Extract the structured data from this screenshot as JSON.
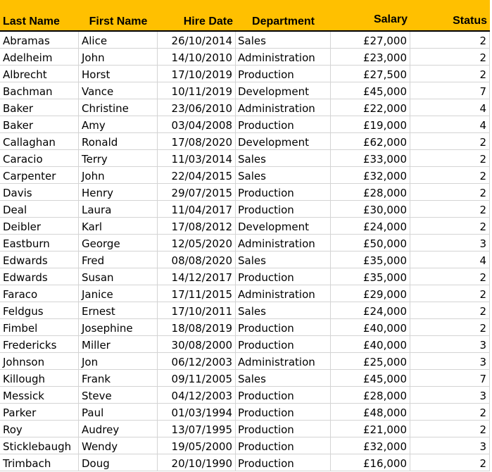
{
  "headers": {
    "last_name": "Last Name",
    "first_name": "First Name",
    "hire_date": "Hire Date",
    "department": "Department",
    "salary": "Salary",
    "status": "Status"
  },
  "rows": [
    {
      "last": "Abramas",
      "first": "Alice",
      "hire": "26/10/2014",
      "dept": "Sales",
      "salary": "£27,000",
      "status": "2"
    },
    {
      "last": "Adelheim",
      "first": "John",
      "hire": "14/10/2010",
      "dept": "Administration",
      "salary": "£23,000",
      "status": "2"
    },
    {
      "last": "Albrecht",
      "first": "Horst",
      "hire": "17/10/2019",
      "dept": "Production",
      "salary": "£27,500",
      "status": "2"
    },
    {
      "last": "Bachman",
      "first": "Vance",
      "hire": "10/11/2019",
      "dept": "Development",
      "salary": "£45,000",
      "status": "7"
    },
    {
      "last": "Baker",
      "first": "Christine",
      "hire": "23/06/2010",
      "dept": "Administration",
      "salary": "£22,000",
      "status": "4"
    },
    {
      "last": "Baker",
      "first": "Amy",
      "hire": "03/04/2008",
      "dept": "Production",
      "salary": "£19,000",
      "status": "4"
    },
    {
      "last": "Callaghan",
      "first": "Ronald",
      "hire": "17/08/2020",
      "dept": "Development",
      "salary": "£62,000",
      "status": "2"
    },
    {
      "last": "Caracio",
      "first": "Terry",
      "hire": "11/03/2014",
      "dept": "Sales",
      "salary": "£33,000",
      "status": "2"
    },
    {
      "last": "Carpenter",
      "first": "John",
      "hire": "22/04/2015",
      "dept": "Sales",
      "salary": "£32,000",
      "status": "2"
    },
    {
      "last": "Davis",
      "first": "Henry",
      "hire": "29/07/2015",
      "dept": "Production",
      "salary": "£28,000",
      "status": "2"
    },
    {
      "last": "Deal",
      "first": "Laura",
      "hire": "11/04/2017",
      "dept": "Production",
      "salary": "£30,000",
      "status": "2"
    },
    {
      "last": "Deibler",
      "first": "Karl",
      "hire": "17/08/2012",
      "dept": "Development",
      "salary": "£24,000",
      "status": "2"
    },
    {
      "last": "Eastburn",
      "first": "George",
      "hire": "12/05/2020",
      "dept": "Administration",
      "salary": "£50,000",
      "status": "3"
    },
    {
      "last": "Edwards",
      "first": "Fred",
      "hire": "08/08/2020",
      "dept": "Sales",
      "salary": "£35,000",
      "status": "4"
    },
    {
      "last": "Edwards",
      "first": "Susan",
      "hire": "14/12/2017",
      "dept": "Production",
      "salary": "£35,000",
      "status": "2"
    },
    {
      "last": "Faraco",
      "first": "Janice",
      "hire": "17/11/2015",
      "dept": "Administration",
      "salary": "£29,000",
      "status": "2"
    },
    {
      "last": "Feldgus",
      "first": "Ernest",
      "hire": "17/10/2011",
      "dept": "Sales",
      "salary": "£24,000",
      "status": "2"
    },
    {
      "last": "Fimbel",
      "first": "Josephine",
      "hire": "18/08/2019",
      "dept": "Production",
      "salary": "£40,000",
      "status": "2"
    },
    {
      "last": "Fredericks",
      "first": "Miller",
      "hire": "30/08/2000",
      "dept": "Production",
      "salary": "£40,000",
      "status": "3"
    },
    {
      "last": "Johnson",
      "first": "Jon",
      "hire": "06/12/2003",
      "dept": "Administration",
      "salary": "£25,000",
      "status": "3"
    },
    {
      "last": "Killough",
      "first": "Frank",
      "hire": "09/11/2005",
      "dept": "Sales",
      "salary": "£45,000",
      "status": "7"
    },
    {
      "last": "Messick",
      "first": "Steve",
      "hire": "04/12/2003",
      "dept": "Production",
      "salary": "£28,000",
      "status": "3"
    },
    {
      "last": "Parker",
      "first": "Paul",
      "hire": "01/03/1994",
      "dept": "Production",
      "salary": "£48,000",
      "status": "2"
    },
    {
      "last": "Roy",
      "first": "Audrey",
      "hire": "13/07/1995",
      "dept": "Production",
      "salary": "£21,000",
      "status": "2"
    },
    {
      "last": "Sticklebaugh",
      "first": "Wendy",
      "hire": "19/05/2000",
      "dept": "Production",
      "salary": "£32,000",
      "status": "3"
    },
    {
      "last": "Trimbach",
      "first": "Doug",
      "hire": "20/10/1990",
      "dept": "Production",
      "salary": "£16,000",
      "status": "2"
    }
  ],
  "colors": {
    "header_fill": "#FFC000",
    "gridline": "#d4d4d4",
    "header_border": "#000000"
  }
}
